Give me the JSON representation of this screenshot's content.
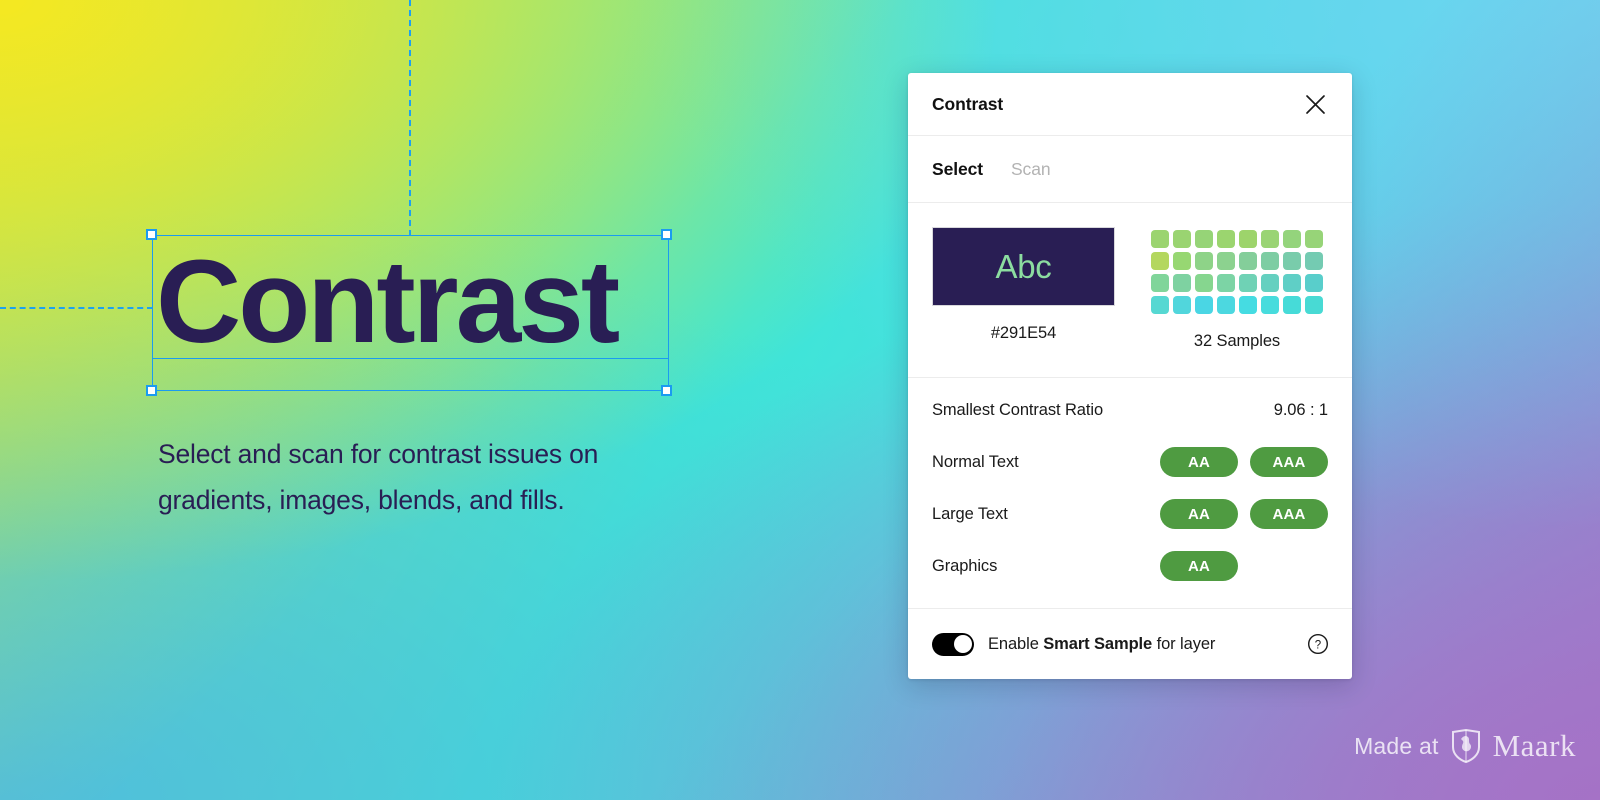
{
  "canvas": {
    "heading": "Contrast",
    "subtitle": "Select and scan for contrast issues on gradients, images, blends, and fills.",
    "heading_color": "#291E54",
    "selection_color": "#1B9BF0"
  },
  "watermark": {
    "made_at": "Made at",
    "brand": "Maark",
    "logo_icon": "shield-logo-icon"
  },
  "panel": {
    "title": "Contrast",
    "close_icon": "close-icon",
    "tabs": [
      {
        "label": "Select",
        "active": true
      },
      {
        "label": "Scan",
        "active": false
      }
    ],
    "swatch": {
      "preview_text": "Abc",
      "background": "#291E54",
      "text_color": "#8CDDA0",
      "caption": "#291E54"
    },
    "samples": {
      "caption": "32 Samples",
      "columns": 8,
      "rows": 4,
      "colors": [
        "#9BD46F",
        "#9AD471",
        "#96D477",
        "#9BD56F",
        "#9DD46B",
        "#9AD474",
        "#94D47C",
        "#97D478",
        "#B4D75E",
        "#97D772",
        "#8ED388",
        "#8CD28F",
        "#84CE9A",
        "#7ECDA3",
        "#79CCAB",
        "#74CBB2",
        "#80D59A",
        "#7ED2A1",
        "#86D68F",
        "#7CD4A5",
        "#6FD2B5",
        "#64D0C0",
        "#5FCFC6",
        "#59CECB",
        "#56D8D2",
        "#51D6DC",
        "#4AD6E4",
        "#4CD8E0",
        "#45DCE2",
        "#47DCDD",
        "#46DBD8",
        "#48DAD4"
      ]
    },
    "results": [
      {
        "label": "Smallest Contrast Ratio",
        "value": "9.06 : 1",
        "badges": []
      },
      {
        "label": "Normal Text",
        "value": "",
        "badges": [
          "AA",
          "AAA"
        ]
      },
      {
        "label": "Large Text",
        "value": "",
        "badges": [
          "AA",
          "AAA"
        ]
      },
      {
        "label": "Graphics",
        "value": "",
        "badges": [
          "AA"
        ]
      }
    ],
    "badge_color": "#4F9B41",
    "footer": {
      "toggle_on": true,
      "toggle_name": "smart-sample-toggle",
      "label_prefix": "Enable ",
      "label_bold": "Smart Sample",
      "label_suffix": " for layer",
      "help_icon": "help-circle-icon"
    }
  }
}
